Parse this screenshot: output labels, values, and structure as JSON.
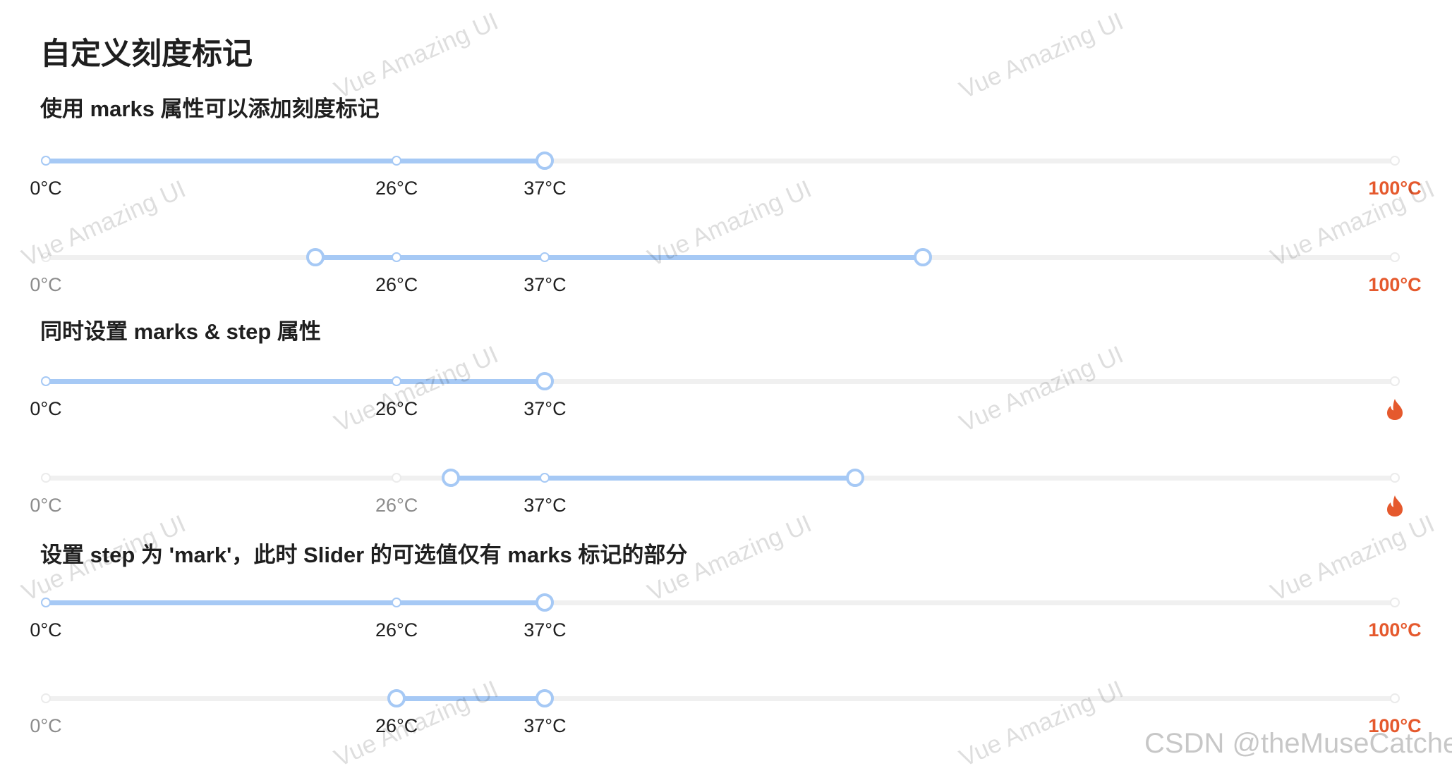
{
  "title": "自定义刻度标记",
  "sections": [
    "使用 marks 属性可以添加刻度标记",
    "同时设置 marks & step 属性",
    "设置 step 为 'mark'，此时 Slider 的可选值仅有 marks 标记的部分"
  ],
  "mark_labels": {
    "m0": "0°C",
    "m26": "26°C",
    "m37": "37°C",
    "m100": "100°C"
  },
  "mark_values": [
    0,
    26,
    37,
    100
  ],
  "flame_icon": "fire-icon",
  "colors": {
    "accent": "#a6c9f5",
    "rail": "#f0f0f0",
    "hot": "#e5592d",
    "dim_text": "#8c8c8c"
  },
  "sliders": [
    {
      "type": "single",
      "value": 37,
      "last_mark": "text"
    },
    {
      "type": "range",
      "value": [
        20,
        65
      ],
      "last_mark": "text"
    },
    {
      "type": "single",
      "value": 37,
      "last_mark": "icon"
    },
    {
      "type": "range",
      "value": [
        30,
        60
      ],
      "last_mark": "icon"
    },
    {
      "type": "single",
      "value": 37,
      "last_mark": "text"
    },
    {
      "type": "range",
      "value": [
        26,
        37
      ],
      "last_mark": "text"
    }
  ],
  "watermark_text": "Vue Amazing UI",
  "csdn_watermark": "CSDN @theMuseCatcher"
}
